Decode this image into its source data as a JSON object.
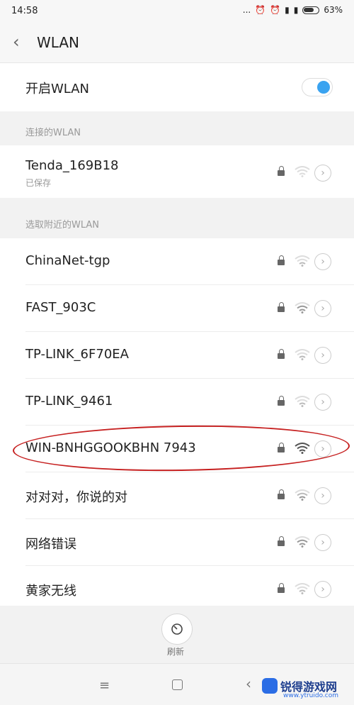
{
  "status_bar": {
    "time": "14:58",
    "dots": "...",
    "battery": "63%"
  },
  "header": {
    "title": "WLAN"
  },
  "wlan_toggle": {
    "label": "开启WLAN",
    "on": true,
    "accent_color": "#3aa3f0"
  },
  "connected": {
    "section_label": "连接的WLAN",
    "network": {
      "name": "Tenda_169B18",
      "status": "已保存"
    }
  },
  "nearby": {
    "section_label": "选取附近的WLAN",
    "networks": [
      {
        "name": "ChinaNet-tgp"
      },
      {
        "name": "FAST_903C"
      },
      {
        "name": "TP-LINK_6F70EA"
      },
      {
        "name": "TP-LINK_9461"
      },
      {
        "name": "WIN-BNHGGOOKBHN 7943",
        "highlighted": true
      },
      {
        "name": "对对对，你说的对"
      },
      {
        "name": "网络错误"
      },
      {
        "name": "黄家无线"
      }
    ]
  },
  "refresh": {
    "label": "刷新"
  },
  "watermark": {
    "text": "锐得游戏网",
    "url": "www.ytruido.com"
  }
}
